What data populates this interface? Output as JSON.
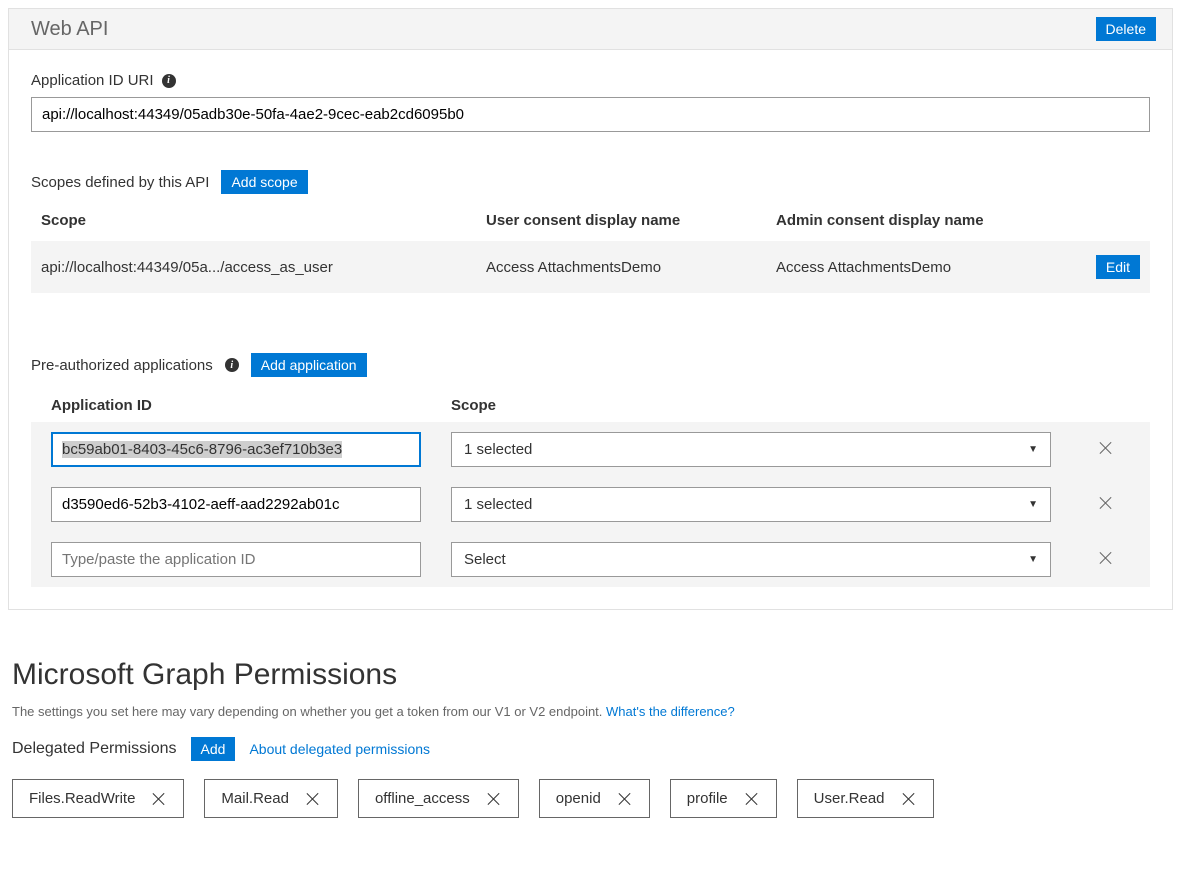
{
  "card": {
    "title": "Web API",
    "delete_label": "Delete"
  },
  "app_id_uri": {
    "label": "Application ID URI",
    "value": "api://localhost:44349/05adb30e-50fa-4ae2-9cec-eab2cd6095b0"
  },
  "scopes": {
    "heading": "Scopes defined by this API",
    "add_label": "Add scope",
    "columns": {
      "scope": "Scope",
      "user_consent": "User consent display name",
      "admin_consent": "Admin consent display name"
    },
    "rows": [
      {
        "scope": "api://localhost:44349/05a.../access_as_user",
        "user_consent": "Access AttachmentsDemo",
        "admin_consent": "Access AttachmentsDemo",
        "edit_label": "Edit"
      }
    ]
  },
  "preauth": {
    "heading": "Pre-authorized applications",
    "add_label": "Add application",
    "columns": {
      "app_id": "Application ID",
      "scope": "Scope"
    },
    "rows": [
      {
        "app_id": "bc59ab01-8403-45c6-8796-ac3ef710b3e3",
        "scope": "1 selected"
      },
      {
        "app_id": "d3590ed6-52b3-4102-aeff-aad2292ab01c",
        "scope": "1 selected"
      }
    ],
    "placeholder": "Type/paste the application ID",
    "select_label": "Select"
  },
  "graph": {
    "heading": "Microsoft Graph Permissions",
    "subtext": "The settings you set here may vary depending on whether you get a token from our V1 or V2 endpoint. ",
    "subtext_link": "What's the difference?",
    "delegated_label": "Delegated Permissions",
    "add_label": "Add",
    "about_link": "About delegated permissions",
    "permissions": [
      "Files.ReadWrite",
      "Mail.Read",
      "offline_access",
      "openid",
      "profile",
      "User.Read"
    ]
  }
}
